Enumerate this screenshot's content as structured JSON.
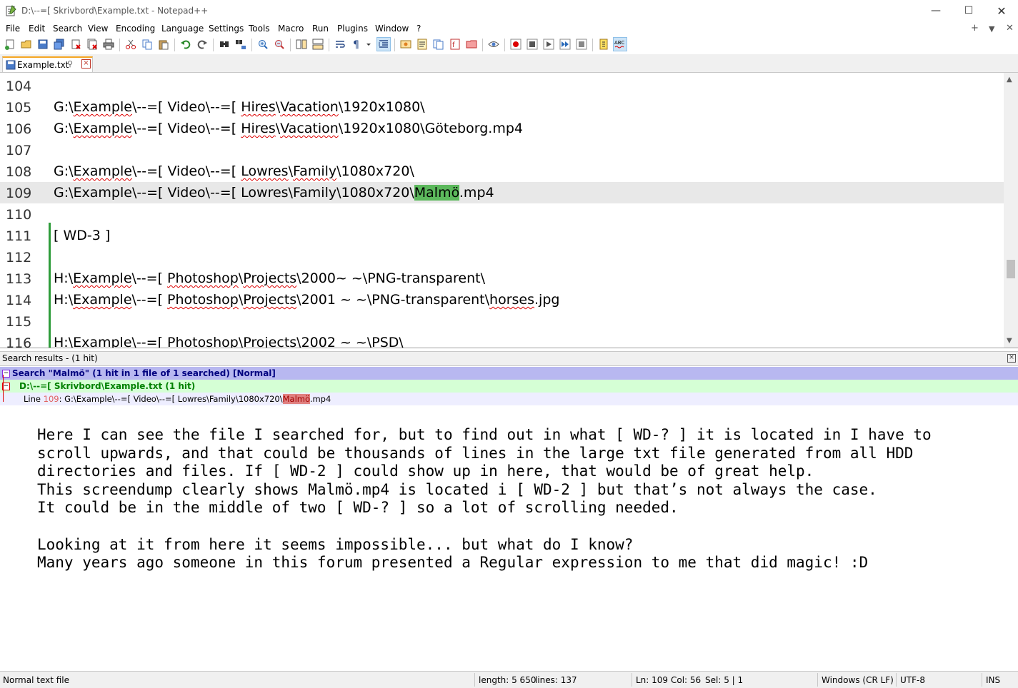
{
  "window": {
    "title": "D:\\--=[ Skrivbord\\Example.txt - Notepad++",
    "minimize": "—",
    "maximize": "☐",
    "close": "✕"
  },
  "menu": {
    "items": [
      "File",
      "Edit",
      "Search",
      "View",
      "Encoding",
      "Language",
      "Settings",
      "Tools",
      "Macro",
      "Run",
      "Plugins",
      "Window",
      "?"
    ],
    "right_plus": "+",
    "right_down": "▼",
    "right_close": "✕"
  },
  "tab": {
    "label": "Example.txt",
    "pin": "⚲",
    "close": "×"
  },
  "editor": {
    "lines": [
      {
        "num": "104",
        "text": ""
      },
      {
        "num": "105",
        "text": "G:\\Example\\--=[ Video\\--=[ Hires\\Vacation\\1920x1080\\"
      },
      {
        "num": "106",
        "text": "G:\\Example\\--=[ Video\\--=[ Hires\\Vacation\\1920x1080\\Göteborg.mp4"
      },
      {
        "num": "107",
        "text": ""
      },
      {
        "num": "108",
        "text": "G:\\Example\\--=[ Video\\--=[ Lowres\\Family\\1080x720\\"
      },
      {
        "num": "109",
        "text_before": "G:\\Example\\--=[ Video\\--=[ Lowres\\Family\\1080x720\\",
        "text_hit": "Malmö",
        "text_after": ".mp4"
      },
      {
        "num": "110",
        "text": ""
      },
      {
        "num": "111",
        "text": "[ WD-3 ]"
      },
      {
        "num": "112",
        "text": ""
      },
      {
        "num": "113",
        "text": "H:\\Example\\--=[ Photoshop\\Projects\\2000~ ~\\PNG-transparent\\"
      },
      {
        "num": "114",
        "text": "H:\\Example\\--=[ Photoshop\\Projects\\2001 ~ ~\\PNG-transparent\\horses.jpg"
      },
      {
        "num": "115",
        "text": ""
      },
      {
        "num": "116",
        "text": "H:\\Example\\--=[ Photoshop\\Projects\\2002 ~ ~\\PSD\\"
      }
    ]
  },
  "search_results": {
    "title": "Search results - (1 hit)",
    "close": "×",
    "search_line": "Search \"Malmö\" (1 hit in 1 file of 1 searched) [Normal]",
    "file_line": "D:\\--=[ Skrivbord\\Example.txt (1 hit)",
    "hit_prefix": "Line ",
    "hit_line_num": "109",
    "hit_text_before": ": G:\\Example\\--=[ Video\\--=[ Lowres\\Family\\1080x720\\",
    "hit_text_match": "Malmö",
    "hit_text_after": ".mp4",
    "fold_minus": "−"
  },
  "note": {
    "text": "Here I can see the file I searched for, but to find out in what [ WD-? ] it is located in I have to\nscroll upwards, and that could be thousands of lines in the large txt file generated from all HDD\ndirectories and files. If [ WD-2 ] could show up in here, that would be of great help.\nThis screendump clearly shows Malmö.mp4 is located i [ WD-2 ] but that’s not always the case.\nIt could be in the middle of two [ WD-? ] so a lot of scrolling needed.\n\nLooking at it from here it seems impossible... but what do I know?\nMany years ago someone in this forum presented a Regular expression to me that did magic! :D"
  },
  "status": {
    "file_type": "Normal text file",
    "length": "length: 5 650",
    "lines": "lines: 137",
    "ln": "Ln: 109",
    "col": "Col: 56",
    "sel": "Sel: 5 | 1",
    "eol": "Windows (CR LF)",
    "encoding": "UTF-8",
    "mode": "INS"
  },
  "colors": {
    "hit_highlight": "#5cb85c",
    "search_row": "#b8b8f0",
    "file_row": "#d5ffd5",
    "change_bar": "#2e9c3a"
  }
}
